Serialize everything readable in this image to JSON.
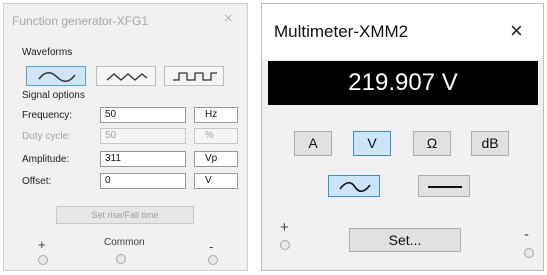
{
  "function_generator": {
    "title": "Function generator-XFG1",
    "waveforms_label": "Waveforms",
    "signal_options_label": "Signal options",
    "rows": [
      {
        "label": "Frequency:",
        "value": "50",
        "unit": "Hz"
      },
      {
        "label": "Duty cycle:",
        "value": "50",
        "unit": "%"
      },
      {
        "label": "Amplitude:",
        "value": "311",
        "unit": "Vp"
      },
      {
        "label": "Offset:",
        "value": "0",
        "unit": "V"
      }
    ],
    "set_button": "Set rise/Fall time",
    "plus": "+",
    "common": "Common",
    "minus": "-"
  },
  "multimeter": {
    "title": "Multimeter-XMM2",
    "reading": "219.907 V",
    "modes": [
      "A",
      "V",
      "Ω",
      "dB"
    ],
    "active_mode": "V",
    "set_button": "Set...",
    "plus": "+",
    "minus": "-"
  },
  "close_glyph": "×"
}
